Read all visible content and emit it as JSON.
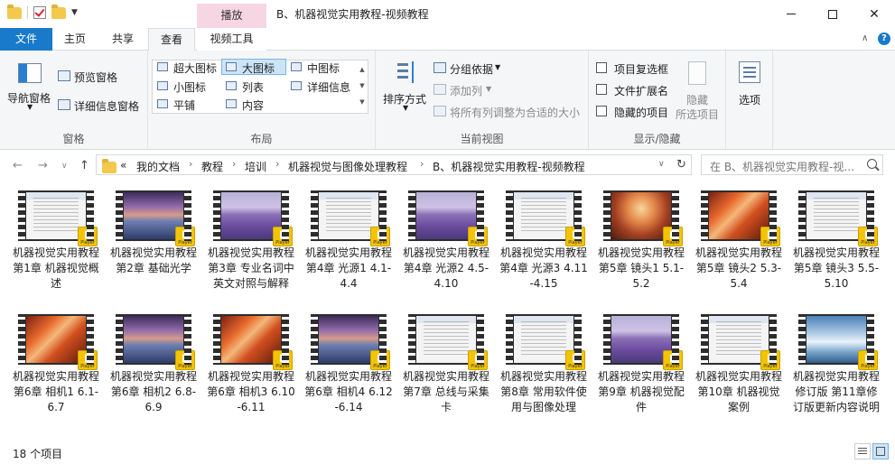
{
  "window": {
    "title": "B、机器视觉实用教程-视频教程",
    "context_tab": "播放"
  },
  "tabs": [
    {
      "label": "文件"
    },
    {
      "label": "主页"
    },
    {
      "label": "共享"
    },
    {
      "label": "查看"
    },
    {
      "label": "视频工具"
    }
  ],
  "ribbon": {
    "panes": {
      "group": "窗格",
      "nav_pane": "导航窗格",
      "preview_pane": "预览窗格",
      "details_pane": "详细信息窗格"
    },
    "layout": {
      "group": "布局",
      "items": [
        "超大图标",
        "大图标",
        "中图标",
        "小图标",
        "列表",
        "详细信息",
        "平铺",
        "内容"
      ],
      "selected": "大图标"
    },
    "current_view": {
      "group": "当前视图",
      "sort": "排序方式",
      "group_by": "分组依据",
      "add_column": "添加列",
      "fit_columns": "将所有列调整为合适的大小"
    },
    "show_hide": {
      "group": "显示/隐藏",
      "item_checkboxes": "项目复选框",
      "file_extensions": "文件扩展名",
      "hidden_items": "隐藏的项目",
      "hide": "隐藏",
      "hide_selected": "所选项目",
      "options": "选项"
    }
  },
  "address": {
    "prefix": "«",
    "crumbs": [
      "我的文档",
      "教程",
      "培训",
      "机器视觉与图像处理教程",
      "B、机器视觉实用教程-视频教程"
    ],
    "search_placeholder": "在 B、机器视觉实用教程-视..."
  },
  "files": [
    {
      "name": "机器视觉实用教程 第1章 机器视觉概述",
      "frame": "doc"
    },
    {
      "name": "机器视觉实用教程 第2章 基础光学",
      "frame": "sea"
    },
    {
      "name": "机器视觉实用教程 第3章 专业名词中英文对照与解释",
      "frame": "lav"
    },
    {
      "name": "机器视觉实用教程 第4章 光源1 4.1-4.4",
      "frame": "doc"
    },
    {
      "name": "机器视觉实用教程 第4章 光源2 4.5-4.10",
      "frame": "lav"
    },
    {
      "name": "机器视觉实用教程 第4章 光源3 4.11-4.15",
      "frame": "doc"
    },
    {
      "name": "机器视觉实用教程 第5章 镜头1 5.1-5.2",
      "frame": "arch"
    },
    {
      "name": "机器视觉实用教程 第5章 镜头2 5.3-5.4",
      "frame": "wave"
    },
    {
      "name": "机器视觉实用教程 第5章 镜头3 5.5-5.10",
      "frame": "doc"
    },
    {
      "name": "机器视觉实用教程 第6章 相机1 6.1-6.7",
      "frame": "wave"
    },
    {
      "name": "机器视觉实用教程 第6章 相机2 6.8-6.9",
      "frame": "sea"
    },
    {
      "name": "机器视觉实用教程 第6章 相机3 6.10-6.11",
      "frame": "wave"
    },
    {
      "name": "机器视觉实用教程 第6章 相机4 6.12-6.14",
      "frame": "sea"
    },
    {
      "name": "机器视觉实用教程 第7章 总线与采集卡",
      "frame": "doc"
    },
    {
      "name": "机器视觉实用教程 第8章 常用软件使用与图像处理",
      "frame": "doc"
    },
    {
      "name": "机器视觉实用教程 第9章 机器视觉配件",
      "frame": "lav"
    },
    {
      "name": "机器视觉实用教程 第10章 机器视觉案例",
      "frame": "doc"
    },
    {
      "name": "机器视觉实用教程修订版 第11章修订版更新内容说明",
      "frame": "ice"
    }
  ],
  "badge_label": "Player",
  "status": {
    "item_count": "18 个项目"
  },
  "colors": {
    "file_tab": "#1979ca",
    "context_tab": "#f7d6e3",
    "selection": "#cce4f7"
  }
}
